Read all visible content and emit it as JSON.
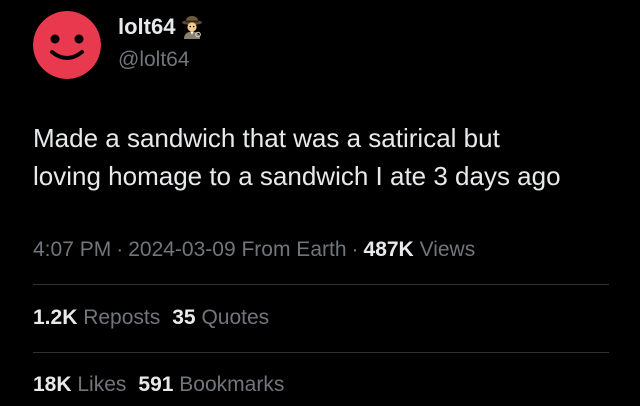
{
  "author": {
    "display_name": "lolt64",
    "handle": "@lolt64",
    "avatar_icon": "smiley-face-avatar",
    "avatar_color": "#e8394f",
    "badge_icon": "detective-emoji-icon"
  },
  "tweet": {
    "text_line_1": "Made a sandwich that was a satirical but",
    "text_line_2": "loving homage to a sandwich I ate 3 days ago"
  },
  "meta": {
    "time": "4:07 PM",
    "separator": "·",
    "date": "2024-03-09",
    "location": "From Earth",
    "views_count": "487K",
    "views_label": "Views"
  },
  "stats": {
    "reposts_count": "1.2K",
    "reposts_label": "Reposts",
    "quotes_count": "35",
    "quotes_label": "Quotes",
    "likes_count": "18K",
    "likes_label": "Likes",
    "bookmarks_count": "591",
    "bookmarks_label": "Bookmarks"
  },
  "colors": {
    "background": "#000000",
    "primary_text": "#e7e9ea",
    "secondary_text": "#71767b",
    "divider": "#2f3336"
  }
}
